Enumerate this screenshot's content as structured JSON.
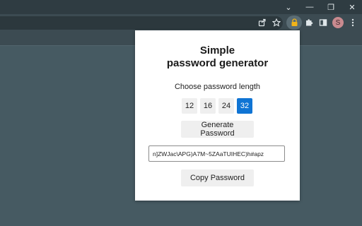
{
  "window": {
    "controls": [
      {
        "name": "tab-search-chevron-icon",
        "glyph": "⌄"
      },
      {
        "name": "minimize-icon",
        "glyph": "—"
      },
      {
        "name": "restore-icon",
        "glyph": "❐"
      },
      {
        "name": "close-icon",
        "glyph": "✕"
      }
    ]
  },
  "toolbar": {
    "icons": [
      "share-icon",
      "bookmark-star-icon",
      "extension-lock-icon",
      "extensions-puzzle-icon",
      "side-panel-icon",
      "profile-avatar",
      "kebab-menu-icon"
    ],
    "avatar_letter": "S",
    "colors": {
      "frame": "#2f3c42",
      "toolbar": "#3c4b52",
      "page_background": "#465a62",
      "avatar": "#c98a8f"
    }
  },
  "popup": {
    "title_line1": "Simple",
    "title_line2": "password generator",
    "length_label": "Choose password length",
    "length_options": [
      "12",
      "16",
      "24",
      "32"
    ],
    "selected_length": "32",
    "generate_label": "Generate Password",
    "password_value": "n]ZWJac\\APG)A7M~5ZAaTUIHEC)h#apz",
    "copy_label": "Copy Password",
    "accent_color": "#0f74d4"
  }
}
